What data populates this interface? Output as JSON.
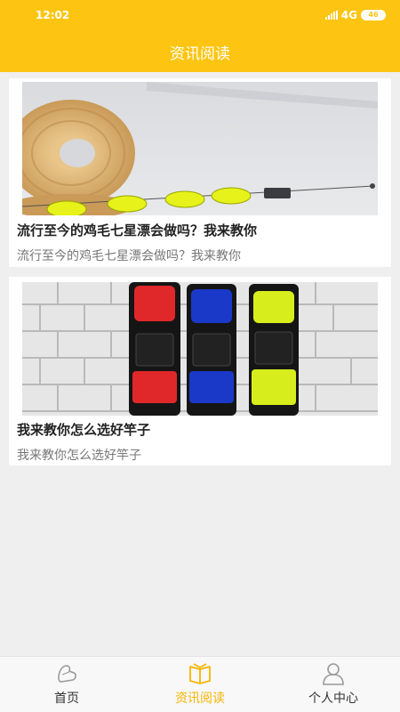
{
  "status_bar": {
    "time": "12:02",
    "network": "4G",
    "battery": "46"
  },
  "header": {
    "title": "资讯阅读"
  },
  "articles": [
    {
      "title": "流行至今的鸡毛七星漂会做吗？我来教你",
      "summary": "流行至今的鸡毛七星漂会做吗？我来教你",
      "image": "fishing-float-line-photo"
    },
    {
      "title": "我来教你怎么选好竿子",
      "summary": "我来教你怎么选好竿子",
      "image": "rod-bags-on-wall-photo"
    }
  ],
  "tabbar": {
    "items": [
      {
        "label": "首页",
        "icon": "shoe-icon"
      },
      {
        "label": "资讯阅读",
        "icon": "book-icon"
      },
      {
        "label": "个人中心",
        "icon": "person-icon"
      }
    ],
    "active_label": "资讯阅读"
  },
  "colors": {
    "accent": "#fdc512",
    "active_tab": "#f5b400",
    "background": "#efefef"
  }
}
